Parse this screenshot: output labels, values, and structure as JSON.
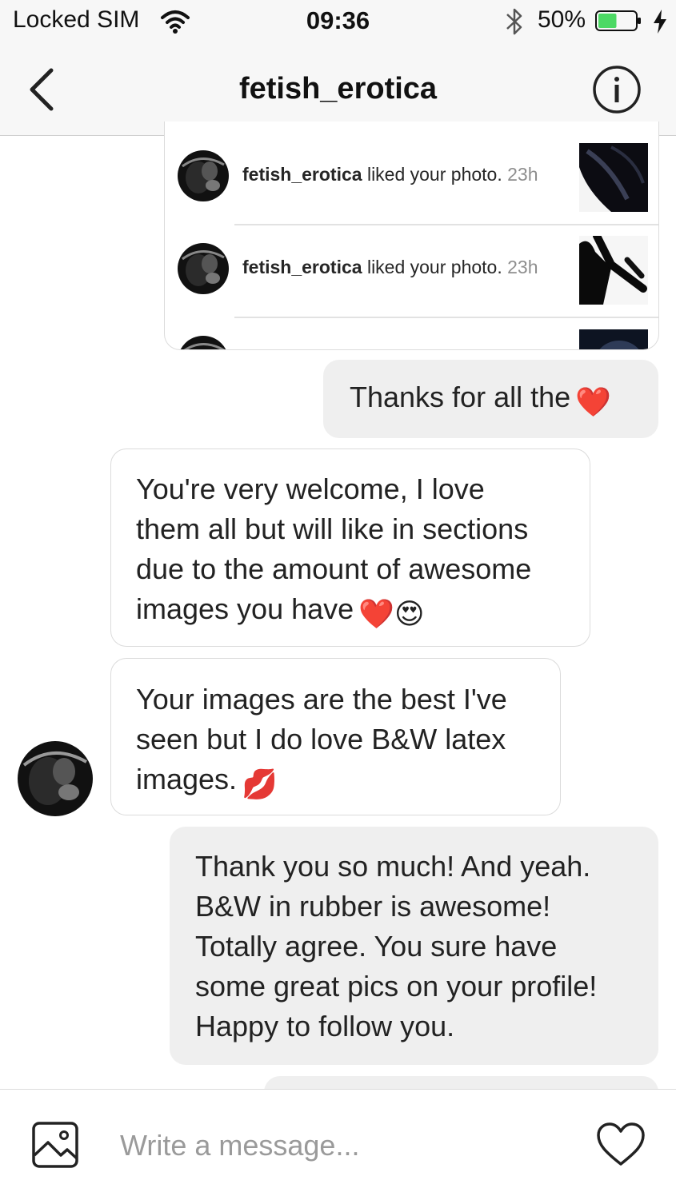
{
  "status_bar": {
    "carrier": "Locked SIM",
    "time": "09:36",
    "battery_percent": "50%",
    "battery_level": 0.5
  },
  "nav": {
    "title": "fetish_erotica"
  },
  "notifications": [
    {
      "user": "fetish_erotica",
      "action": " liked your photo. ",
      "time": "23h"
    },
    {
      "user": "fetish_erotica",
      "action": " liked your photo. ",
      "time": "23h"
    }
  ],
  "messages": {
    "m1": {
      "text": "Thanks for all the",
      "emoji": "❤️"
    },
    "m2": {
      "line1": "You're very welcome, I love",
      "line2": "them all but will like in sections",
      "line3": "due to the amount of awesome",
      "line4": "images you have",
      "emoji": "❤️😍"
    },
    "m3": {
      "line1": "Your images are the best I've",
      "line2": "seen but I do love B&W latex",
      "line3": "images.",
      "emoji": "💋"
    },
    "m4": {
      "line1": "Thank you so much! And yeah.",
      "line2": "B&W in rubber is awesome!",
      "line3": "Totally agree. You sure have",
      "line4": "some great pics on your profile!",
      "line5": "Happy to follow you."
    }
  },
  "composer": {
    "placeholder": "Write a message..."
  },
  "icons": [
    "back-chevron-icon",
    "info-icon",
    "wifi-icon",
    "bluetooth-icon",
    "battery-icon",
    "charging-bolt-icon",
    "photo-gallery-icon",
    "heart-icon"
  ],
  "colors": {
    "battery_fill": "#4cd964",
    "outgoing_bubble": "#efefef",
    "bar_background": "#f7f7f7",
    "timestamp": "#8e8e8e"
  }
}
